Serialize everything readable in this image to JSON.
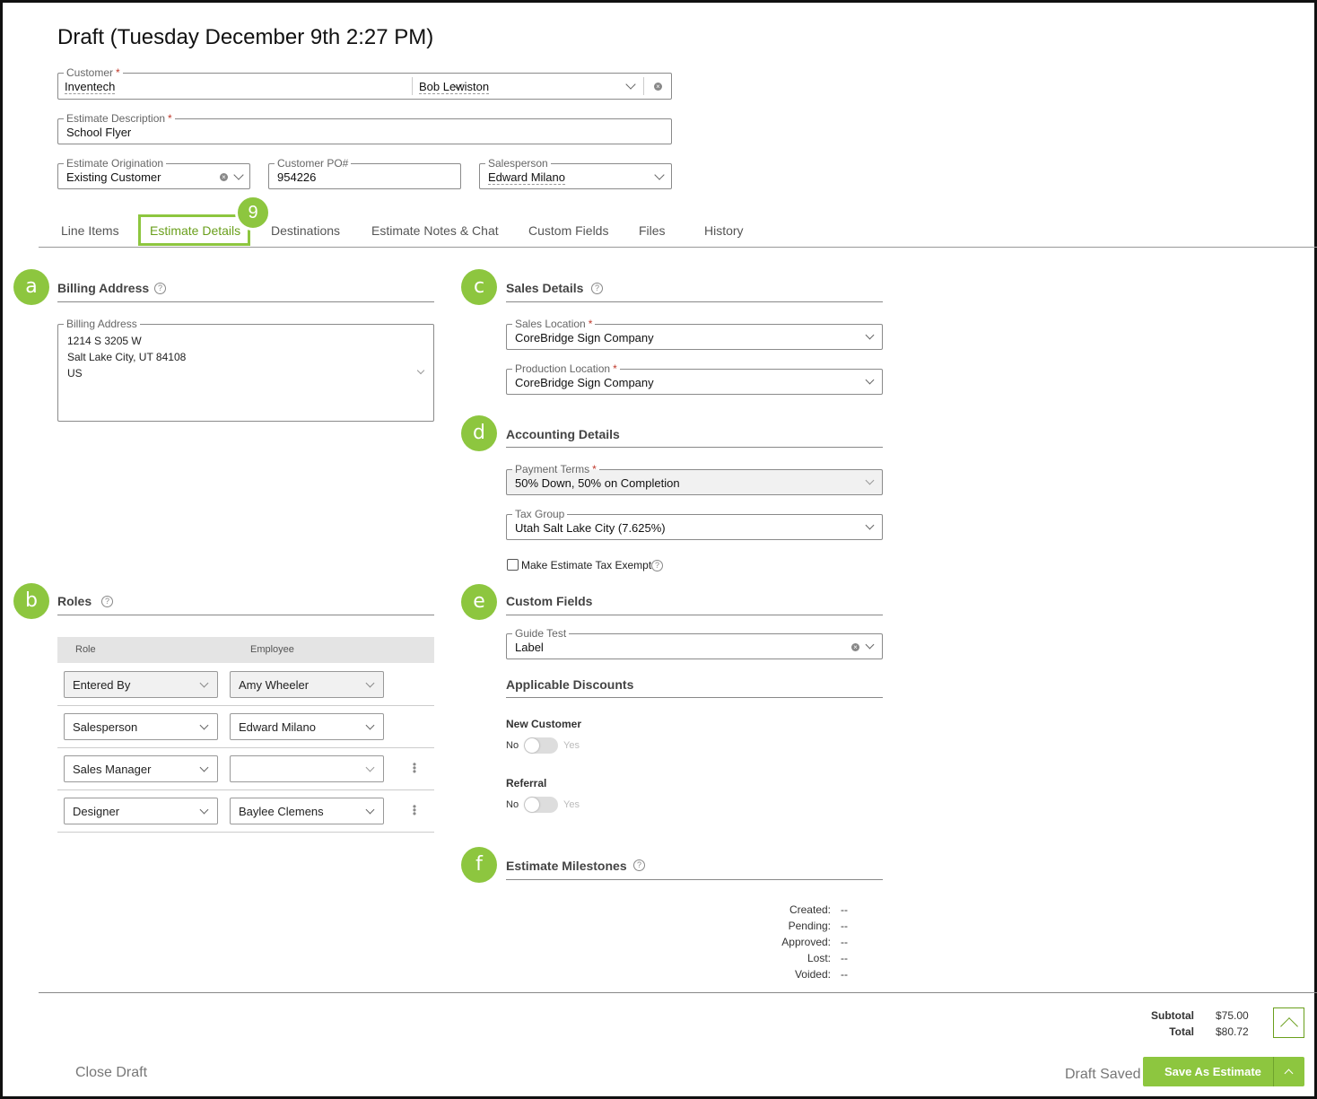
{
  "header": {
    "title": "Draft (Tuesday December 9th 2:27 PM)"
  },
  "form": {
    "customer": {
      "label": "Customer",
      "value": "Inventech",
      "contact": "Bob Lewiston"
    },
    "description": {
      "label": "Estimate Description",
      "value": "School Flyer"
    },
    "origination": {
      "label": "Estimate Origination",
      "value": "Existing Customer"
    },
    "po": {
      "label": "Customer PO#",
      "value": "954226"
    },
    "salesperson": {
      "label": "Salesperson",
      "value": "Edward Milano"
    },
    "required_mark": "*"
  },
  "tabs": [
    {
      "label": "Line Items"
    },
    {
      "label": "Estimate Details"
    },
    {
      "label": "Destinations"
    },
    {
      "label": "Estimate Notes & Chat"
    },
    {
      "label": "Custom Fields"
    },
    {
      "label": "Files"
    },
    {
      "label": "History"
    }
  ],
  "callouts": {
    "step": "9",
    "a": "a",
    "b": "b",
    "c": "c",
    "d": "d",
    "e": "e",
    "f": "f"
  },
  "billing": {
    "heading": "Billing Address",
    "field_label": "Billing Address",
    "lines": [
      "1214 S 3205 W",
      "Salt Lake City, UT 84108",
      "US"
    ]
  },
  "roles": {
    "heading": "Roles",
    "col_role": "Role",
    "col_employee": "Employee",
    "rows": [
      {
        "role": "Entered By",
        "employee": "Amy Wheeler"
      },
      {
        "role": "Salesperson",
        "employee": "Edward Milano"
      },
      {
        "role": "Sales Manager",
        "employee": ""
      },
      {
        "role": "Designer",
        "employee": "Baylee Clemens"
      }
    ]
  },
  "sales": {
    "heading": "Sales Details",
    "sales_location": {
      "label": "Sales Location",
      "value": "CoreBridge Sign Company"
    },
    "production_location": {
      "label": "Production Location",
      "value": "CoreBridge Sign Company"
    }
  },
  "accounting": {
    "heading": "Accounting Details",
    "payment_terms": {
      "label": "Payment Terms",
      "value": "50% Down, 50% on Completion"
    },
    "tax_group": {
      "label": "Tax Group",
      "value": "Utah Salt Lake City (7.625%)"
    },
    "tax_exempt_label": "Make Estimate Tax Exempt"
  },
  "custom_fields": {
    "heading": "Custom Fields",
    "guide_test": {
      "label": "Guide Test",
      "value": "Label"
    }
  },
  "discounts": {
    "heading": "Applicable Discounts",
    "items": [
      {
        "name": "New Customer",
        "no": "No",
        "yes": "Yes"
      },
      {
        "name": "Referral",
        "no": "No",
        "yes": "Yes"
      }
    ]
  },
  "milestones": {
    "heading": "Estimate Milestones",
    "rows": [
      {
        "label": "Created:",
        "value": "--"
      },
      {
        "label": "Pending:",
        "value": "--"
      },
      {
        "label": "Approved:",
        "value": "--"
      },
      {
        "label": "Lost:",
        "value": "--"
      },
      {
        "label": "Voided:",
        "value": "--"
      }
    ]
  },
  "footer": {
    "subtotal_label": "Subtotal",
    "subtotal": "$75.00",
    "total_label": "Total",
    "total": "$80.72",
    "close_draft": "Close Draft",
    "draft_saved": "Draft Saved",
    "save_as_estimate": "Save As Estimate"
  },
  "colors": {
    "accent": "#8dc63f",
    "accent_dark": "#6a9f1c",
    "required": "#c0392b"
  },
  "icons": [
    "chevron-down-icon",
    "clear-icon",
    "help-icon",
    "kebab-icon",
    "chevron-up-icon"
  ]
}
